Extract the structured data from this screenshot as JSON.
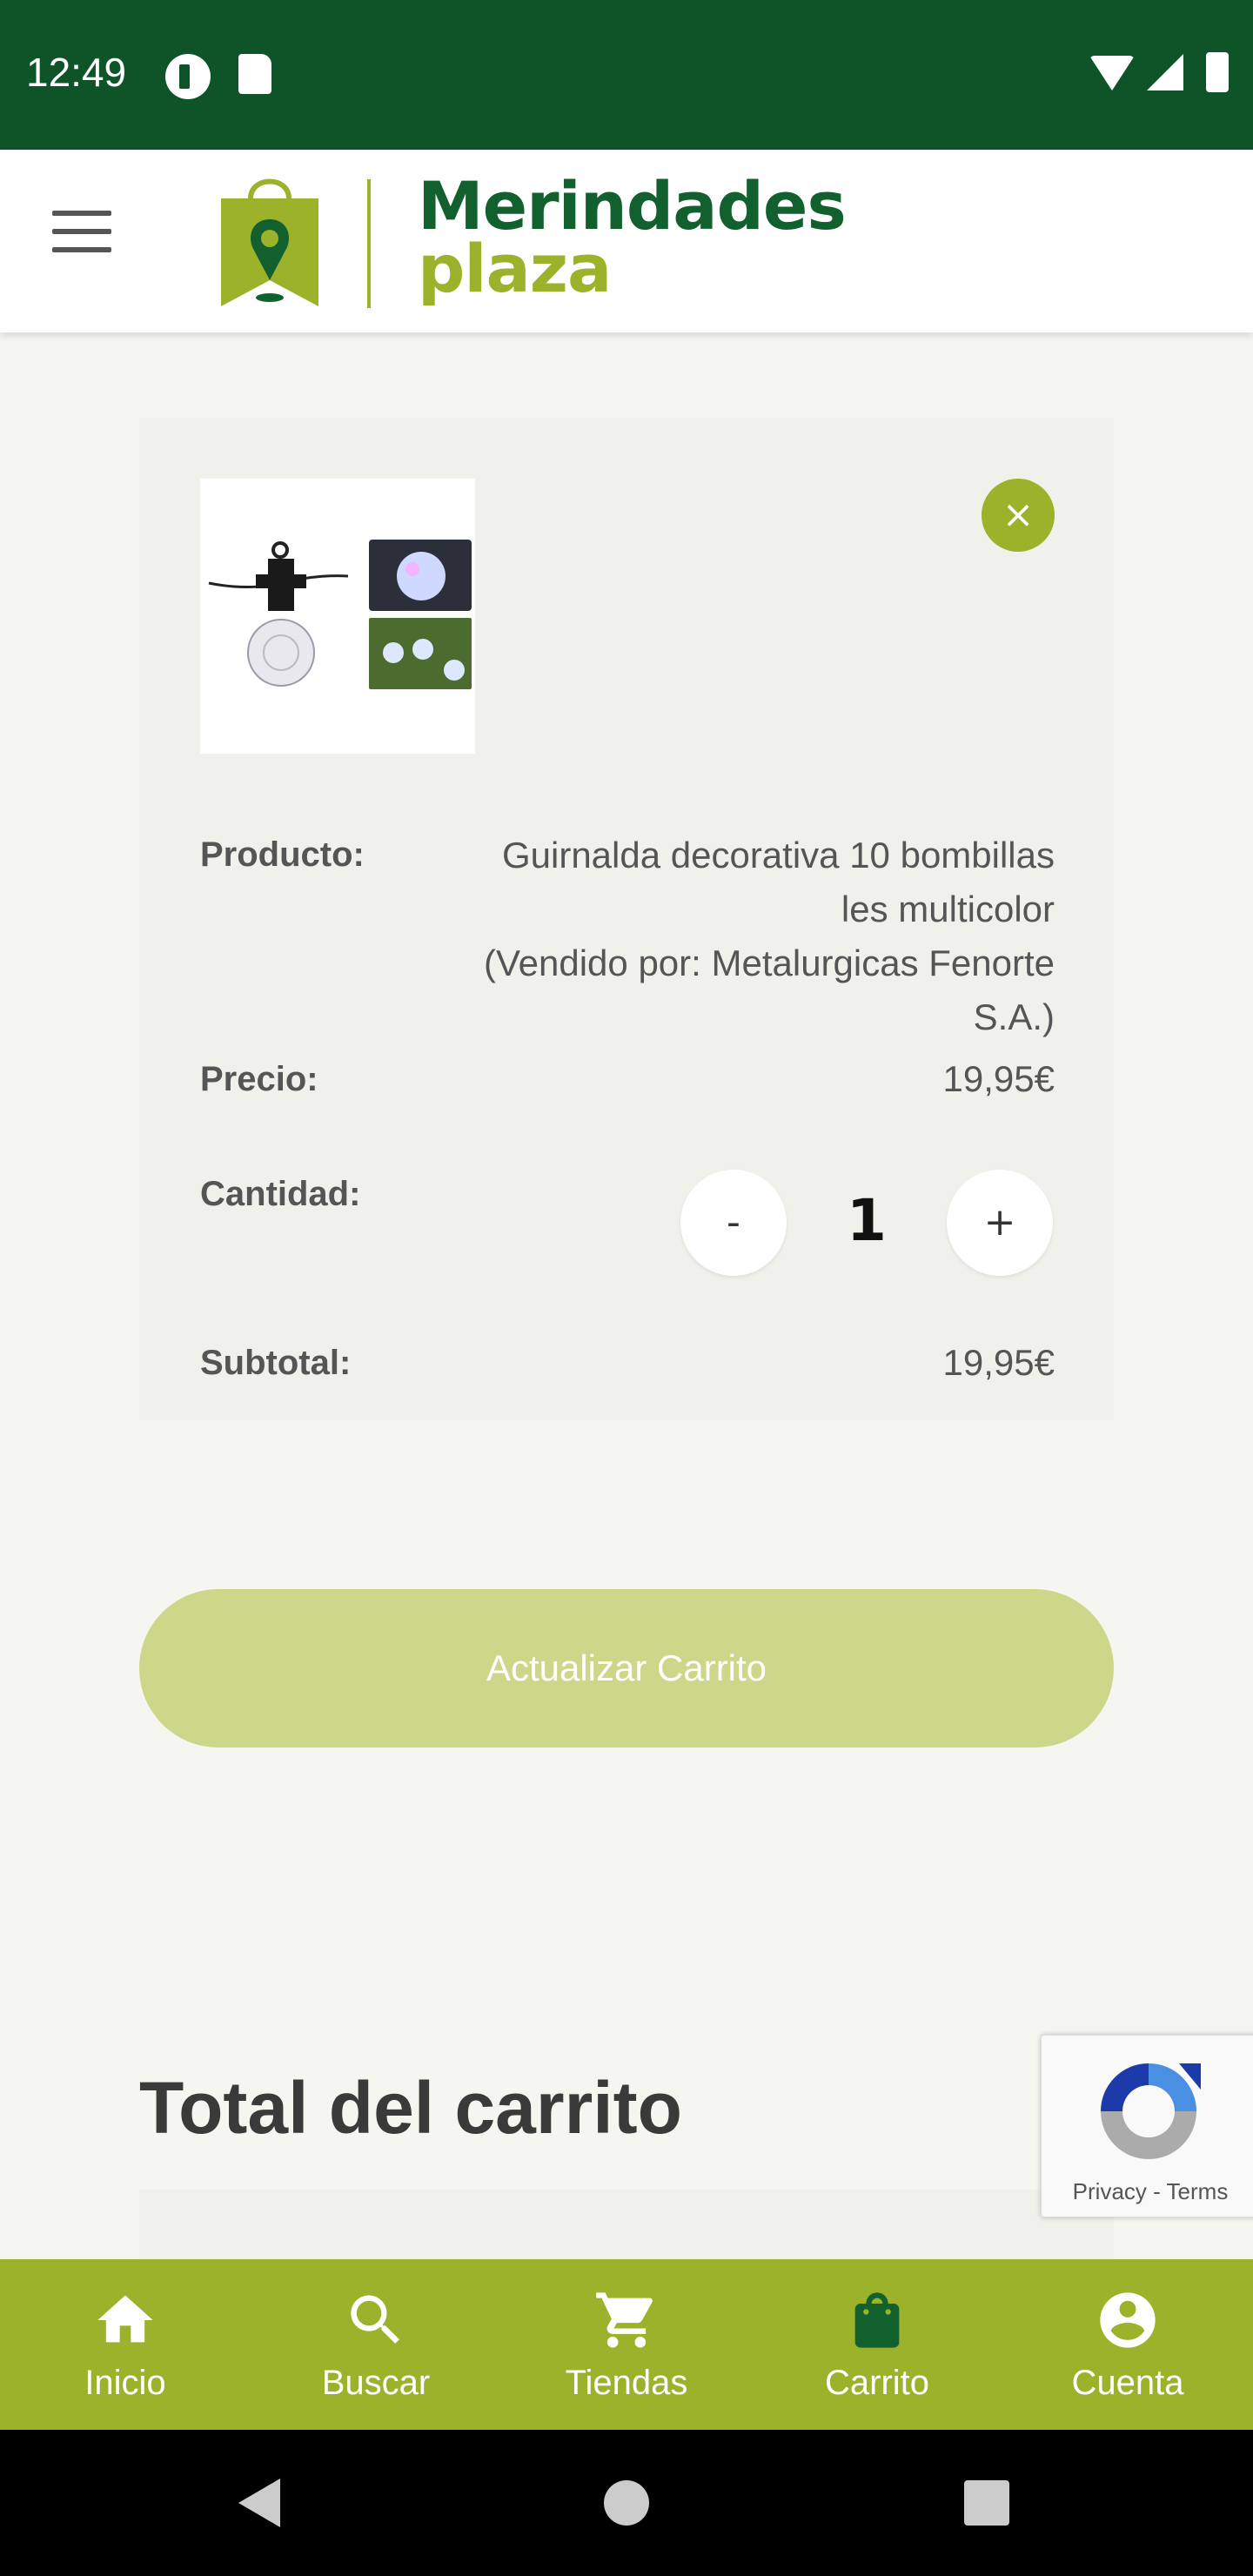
{
  "status_bar": {
    "time": "12:49"
  },
  "header": {
    "brand_line1": "Merindades",
    "brand_line2": "plaza"
  },
  "cart_item": {
    "product_label": "Producto:",
    "product_name_line1": "Guirnalda decorativa 10 bombillas",
    "product_name_line2": "les multicolor",
    "product_name_line3": "(Vendido por: Metalurgicas Fenorte S.A.)",
    "price_label": "Precio:",
    "price_value": "19,95€",
    "quantity_label": "Cantidad:",
    "quantity_value": "1",
    "minus_label": "-",
    "plus_label": "+",
    "subtotal_label": "Subtotal:",
    "subtotal_value": "19,95€",
    "remove_label": "×"
  },
  "update_button": "Actualizar Carrito",
  "totals_title": "Total del carrito",
  "recaptcha": {
    "text": "Privacy - Terms"
  },
  "bottom_nav": [
    {
      "label": "Inicio",
      "icon": "home-icon"
    },
    {
      "label": "Buscar",
      "icon": "search-icon"
    },
    {
      "label": "Tiendas",
      "icon": "cart-icon"
    },
    {
      "label": "Carrito",
      "icon": "bag-icon",
      "active": true
    },
    {
      "label": "Cuenta",
      "icon": "account-icon"
    }
  ],
  "colors": {
    "primary_dark": "#0f5429",
    "accent": "#9bb22a",
    "update_button": "#cdd78a",
    "active_nav_icon": "#11602d"
  }
}
